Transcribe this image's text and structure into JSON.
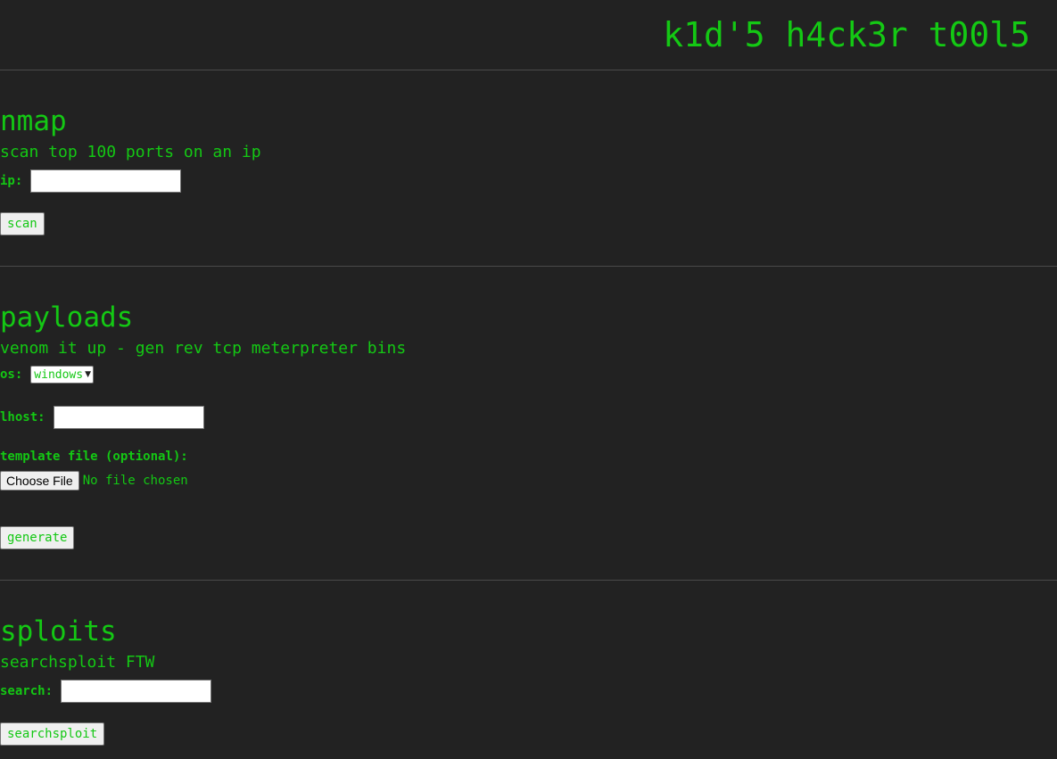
{
  "header": {
    "title": "k1d'5 h4ck3r t00l5"
  },
  "nmap": {
    "title": "nmap",
    "description": "scan top 100 ports on an ip",
    "ip_label": "ip:",
    "ip_value": "",
    "scan_label": "scan"
  },
  "payloads": {
    "title": "payloads",
    "description": "venom it up - gen rev tcp meterpreter bins",
    "os_label": "os:",
    "os_selected": "windows",
    "lhost_label": "lhost:",
    "lhost_value": "",
    "template_label": "template file (optional):",
    "choose_file_label": "Choose File",
    "no_file_text": "No file chosen",
    "generate_label": "generate"
  },
  "sploits": {
    "title": "sploits",
    "description": "searchsploit FTW",
    "search_label": "search:",
    "search_value": "",
    "searchsploit_label": "searchsploit"
  },
  "colors": {
    "background": "#222222",
    "text": "#14c814",
    "divider": "#4a4a4a"
  }
}
